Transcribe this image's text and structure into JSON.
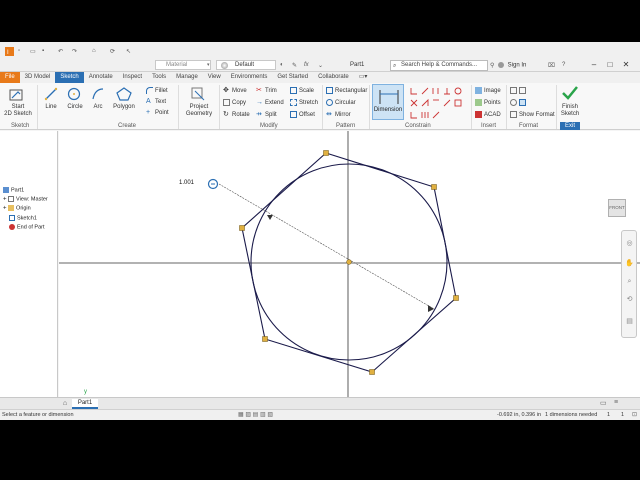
{
  "quick_access": {
    "material": "Material",
    "appearance": "Default",
    "document_title": "Part1",
    "search_placeholder": "Search Help & Commands...",
    "sign_in": "Sign In"
  },
  "tabs": [
    "File",
    "3D Model",
    "Sketch",
    "Annotate",
    "Inspect",
    "Tools",
    "Manage",
    "View",
    "Environments",
    "Get Started",
    "Collaborate"
  ],
  "active_tab": "Sketch",
  "ribbon": {
    "sketch": {
      "start_label_1": "Start",
      "start_label_2": "2D Sketch",
      "group": "Sketch"
    },
    "create": {
      "line": "Line",
      "circle": "Circle",
      "arc": "Arc",
      "polygon": "Polygon",
      "fillet": "Fillet",
      "text": "Text",
      "point": "Point",
      "group": "Create"
    },
    "project": {
      "label_1": "Project",
      "label_2": "Geometry"
    },
    "modify": {
      "move": "Move",
      "copy": "Copy",
      "rotate": "Rotate",
      "trim": "Trim",
      "extend": "Extend",
      "split": "Split",
      "scale": "Scale",
      "stretch": "Stretch",
      "offset": "Offset",
      "group": "Modify"
    },
    "pattern": {
      "rectangular": "Rectangular",
      "circular": "Circular",
      "mirror": "Mirror",
      "group": "Pattern"
    },
    "constrain": {
      "dimension": "Dimension",
      "group": "Constrain"
    },
    "insert": {
      "image": "Image",
      "points": "Points",
      "acad": "ACAD",
      "group": "Insert"
    },
    "format": {
      "show_format": "Show Format",
      "group": "Format"
    },
    "exit": {
      "finish_1": "Finish",
      "finish_2": "Sketch",
      "group": "Exit"
    }
  },
  "browser": {
    "items": [
      "Part1",
      "View: Master",
      "Origin",
      "Sketch1",
      "End of Part"
    ]
  },
  "canvas": {
    "dimension_value": "1.001",
    "viewcube_face": "FRONT",
    "axis_x": "x",
    "axis_y": "y"
  },
  "doc_tabs": {
    "active": "Part1"
  },
  "status": {
    "prompt": "Select a feature or dimension",
    "coordinates": "-0.692 in, 0.396 in",
    "dimensions_needed": "1 dimensions needed",
    "count_1": "1",
    "count_2": "1"
  },
  "colors": {
    "file_tab": "#e87a1a",
    "active_tab": "#2b6fb3",
    "finish_check": "#2aa44a",
    "sketch_line": "#1a1a4a",
    "vertex": "#e0b040"
  }
}
